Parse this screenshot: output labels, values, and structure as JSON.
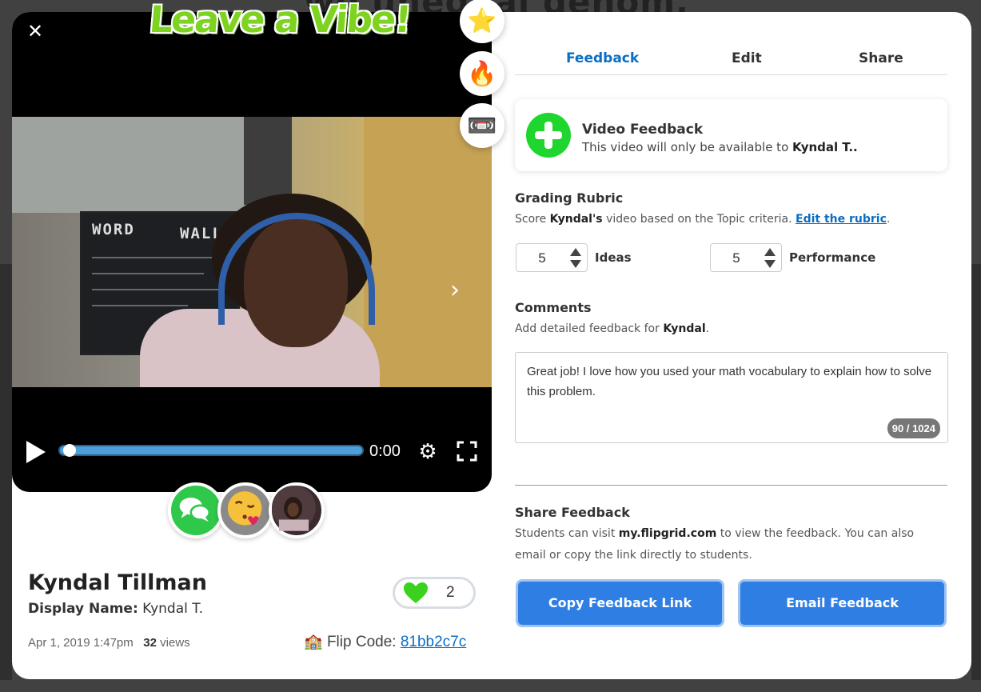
{
  "background": {
    "title_partial": "wo unequal denom."
  },
  "vibe": {
    "title": "Leave a Vibe!",
    "buttons": [
      {
        "icon": "star-icon",
        "glyph": "⭐"
      },
      {
        "icon": "fire-icon",
        "glyph": "🔥"
      },
      {
        "icon": "cassette-icon",
        "glyph": "📼"
      }
    ]
  },
  "video": {
    "board_text_1": "WORD",
    "board_text_2": "WALL",
    "current_time": "0:00",
    "progress": 0.0
  },
  "student": {
    "name": "Kyndal Tillman",
    "display_name_label": "Display Name:",
    "display_name": "Kyndal T.",
    "date": "Apr 1, 2019 1:47pm",
    "views_count": "32",
    "views_label": "views",
    "likes": "2",
    "flip_code_label": "Flip Code:",
    "flip_code": "81bb2c7c"
  },
  "tabs": [
    {
      "label": "Feedback",
      "active": true
    },
    {
      "label": "Edit",
      "active": false
    },
    {
      "label": "Share",
      "active": false
    }
  ],
  "video_feedback": {
    "title": "Video Feedback",
    "subtitle_prefix": "This video will only be available to",
    "subtitle_name": "Kyndal T.."
  },
  "rubric": {
    "heading": "Grading Rubric",
    "desc_prefix": "Score",
    "desc_name": "Kyndal's",
    "desc_middle": "video based on the Topic criteria.",
    "edit_link": "Edit the rubric",
    "desc_suffix": ".",
    "criteria": [
      {
        "value": "5",
        "label": "Ideas"
      },
      {
        "value": "5",
        "label": "Performance"
      }
    ]
  },
  "comments": {
    "heading": "Comments",
    "desc_prefix": "Add detailed feedback for",
    "desc_name": "Kyndal",
    "desc_suffix": ".",
    "text": "Great job! I love how you used your math vocabulary to explain how to solve this problem.",
    "counter": "90 / 1024"
  },
  "share": {
    "heading": "Share Feedback",
    "desc_prefix": "Students can visit",
    "desc_site": "my.flipgrid.com",
    "desc_suffix": "to view the feedback. You can also email or copy the link directly to students.",
    "copy_button": "Copy Feedback Link",
    "email_button": "Email Feedback"
  },
  "colors": {
    "accent": "#0a6ec4",
    "button": "#2f7ee3",
    "plus_green": "#1ed62d",
    "vibe_green": "#7ed321"
  }
}
